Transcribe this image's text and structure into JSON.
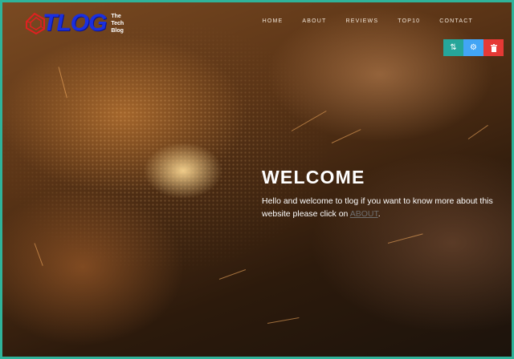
{
  "brand": {
    "logo_text": "TLOG",
    "tagline_lines": [
      "The",
      "Tech",
      "Blog"
    ]
  },
  "nav": {
    "items": [
      "HOME",
      "ABOUT",
      "REVIEWS",
      "TOP10",
      "CONTACT"
    ]
  },
  "toolbar": {
    "move_icon": "move-icon",
    "settings_icon": "gear-icon",
    "delete_icon": "trash-icon"
  },
  "hero": {
    "heading": "WELCOME",
    "text_before_link": "Hello and welcome to tlog if you want to know more about this website please click on ",
    "link_text": "ABOUT",
    "text_after_link": "."
  },
  "colors": {
    "frame": "#2fb39a",
    "logo_blue": "#1a2fe0",
    "logo_red": "#e02020",
    "move_button": "#26a69a",
    "settings_button": "#42a5f5",
    "delete_button": "#e53935"
  }
}
